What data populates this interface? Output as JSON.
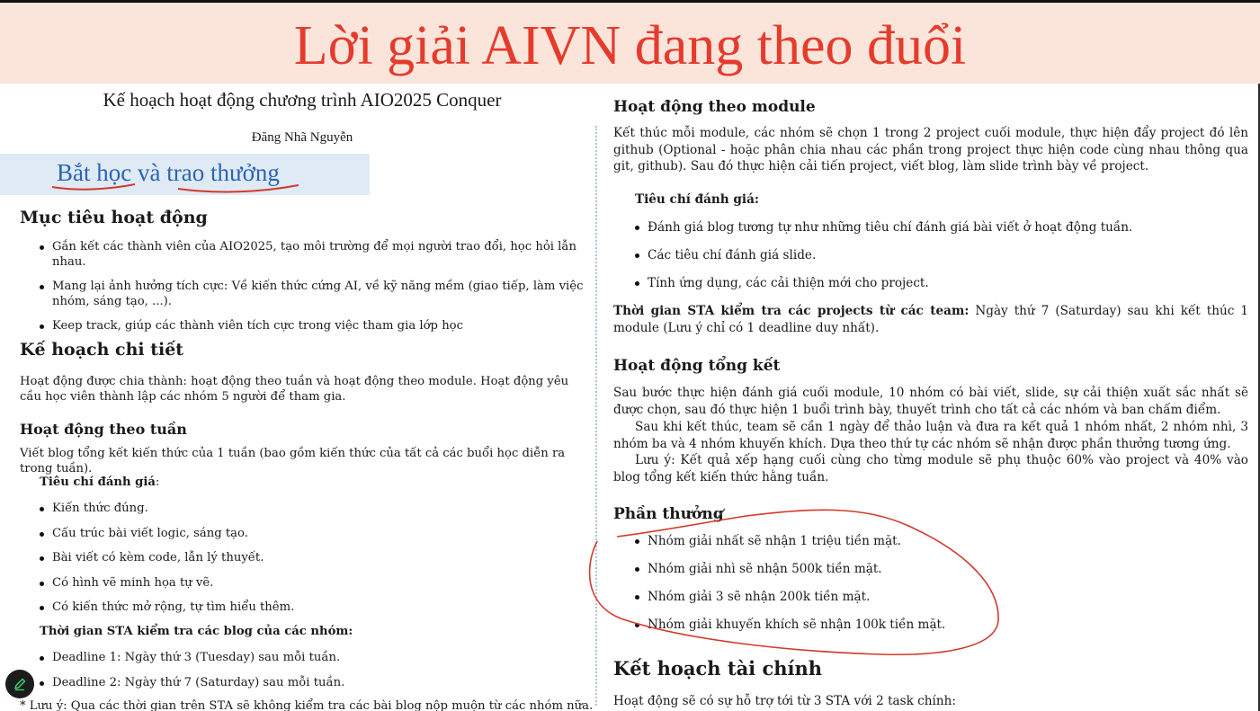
{
  "banner": {
    "title": "Lời giải AIVN đang theo đuổi"
  },
  "document": {
    "title": "Kế hoạch hoạt động chương trình AIO2025 Conquer",
    "author": "Đăng Nhã Nguyễn",
    "highlight": "Bắt học và trao thưởng"
  },
  "left": {
    "goals": {
      "heading": "Mục tiêu hoạt động",
      "items": [
        "Gắn kết các thành viên của AIO2025, tạo môi trường để mọi người trao đổi, học hỏi lẫn nhau.",
        "Mang lại ảnh hưởng tích cực: Về kiến thức cứng AI, về kỹ năng mềm (giao tiếp, làm việc nhóm, sáng tạo, ...).",
        "Keep track, giúp các thành viên tích cực trong việc tham gia lớp học"
      ]
    },
    "plan": {
      "heading": "Kế hoạch chi tiết",
      "text": "Hoạt động được chia thành: hoạt động theo tuần và hoạt động theo module. Hoạt động yêu cầu học viên thành lập các nhóm 5 người để tham gia."
    },
    "weekly": {
      "heading": "Hoạt động theo tuần",
      "text": "Viết blog tổng kết kiến thức của 1 tuần (bao gồm kiến thức của tất cả các buổi học diễn ra trong tuần).",
      "criteria_label": "Tiêu chí đánh giá",
      "criteria_colon": ":",
      "criteria": [
        "Kiến thức đúng.",
        "Cấu trúc bài viết logic, sáng tạo.",
        "Bài viết có kèm code, lẫn lý thuyết.",
        "Có hình vẽ minh họa tự vẽ.",
        "Có kiến thức mở rộng, tự tìm hiểu thêm."
      ],
      "sta_label": "Thời gian STA kiểm tra các blog của các nhóm:",
      "deadlines": [
        "Deadline 1: Ngày thứ 3 (Tuesday) sau mỗi tuần.",
        "Deadline 2: Ngày thứ 7 (Saturday) sau mỗi tuần."
      ],
      "note": "* Lưu ý: Qua các thời gian trên STA sẽ không kiểm tra các bài blog nộp muộn từ các nhóm nữa."
    }
  },
  "right": {
    "module": {
      "heading": "Hoạt động theo module",
      "text": "Kết thúc mỗi module, các nhóm sẽ chọn 1 trong 2 project cuối module, thực hiện đẩy project đó lên github (Optional - hoặc phân chia nhau các phần trong project thực hiện code cùng nhau thông qua git, github). Sau đó thực hiện cải tiến project, viết blog, làm slide trình bày về project.",
      "criteria_label": "Tiêu chí đánh giá:",
      "criteria": [
        "Đánh giá blog tương tự như những tiêu chí đánh giá bài viết ở hoạt động tuần.",
        "Các tiêu chí đánh giá slide.",
        "Tính ứng dụng, các cải thiện mới cho project."
      ],
      "sta_label": "Thời gian STA kiểm tra các projects từ các team:",
      "sta_text": " Ngày thứ 7 (Saturday) sau khi kết thúc 1 module (Lưu ý chỉ có 1 deadline duy nhất)."
    },
    "summary": {
      "heading": "Hoạt động tổng kết",
      "p1": "Sau bước thực hiện đánh giá cuối module, 10 nhóm có bài viết, slide, sự cải thiện xuất sắc nhất sẽ được chọn, sau đó thực hiện 1 buổi trình bày, thuyết trình cho tất cả các nhóm và ban chấm điểm.",
      "p2": "Sau khi kết thúc, team sẽ cần 1 ngày để thảo luận và đưa ra kết quả 1 nhóm nhất, 2 nhóm nhì, 3 nhóm ba và 4 nhóm khuyến khích. Dựa theo thứ tự các nhóm sẽ nhận được phần thưởng tương ứng.",
      "p3": "Lưu ý: Kết quả xếp hạng cuối cùng cho từng module sẽ phụ thuộc 60% vào project và 40% vào blog tổng kết kiến thức hằng tuần."
    },
    "rewards": {
      "heading": "Phần thưởng",
      "items": [
        "Nhóm giải nhất sẽ nhận 1 triệu tiền mặt.",
        "Nhóm giải nhì sẽ nhận 500k tiền mặt.",
        "Nhóm giải 3 sẽ nhận 200k tiền mặt.",
        "Nhóm giải khuyến khích sẽ nhận 100k tiền mặt."
      ]
    },
    "finance": {
      "heading": "Kết hoạch tài chính",
      "text": "Hoạt động sẽ có sự hỗ trợ tới từ 3 STA với 2 task chính:"
    }
  },
  "colors": {
    "banner_bg": "#fbe5db",
    "banner_text": "#e53b2c",
    "highlight_bg": "#dfeaf4",
    "highlight_text": "#2a64b7",
    "ink": "#d13a2a"
  },
  "icons": {
    "pen": "pen-icon",
    "status": "status-dot-icon"
  }
}
